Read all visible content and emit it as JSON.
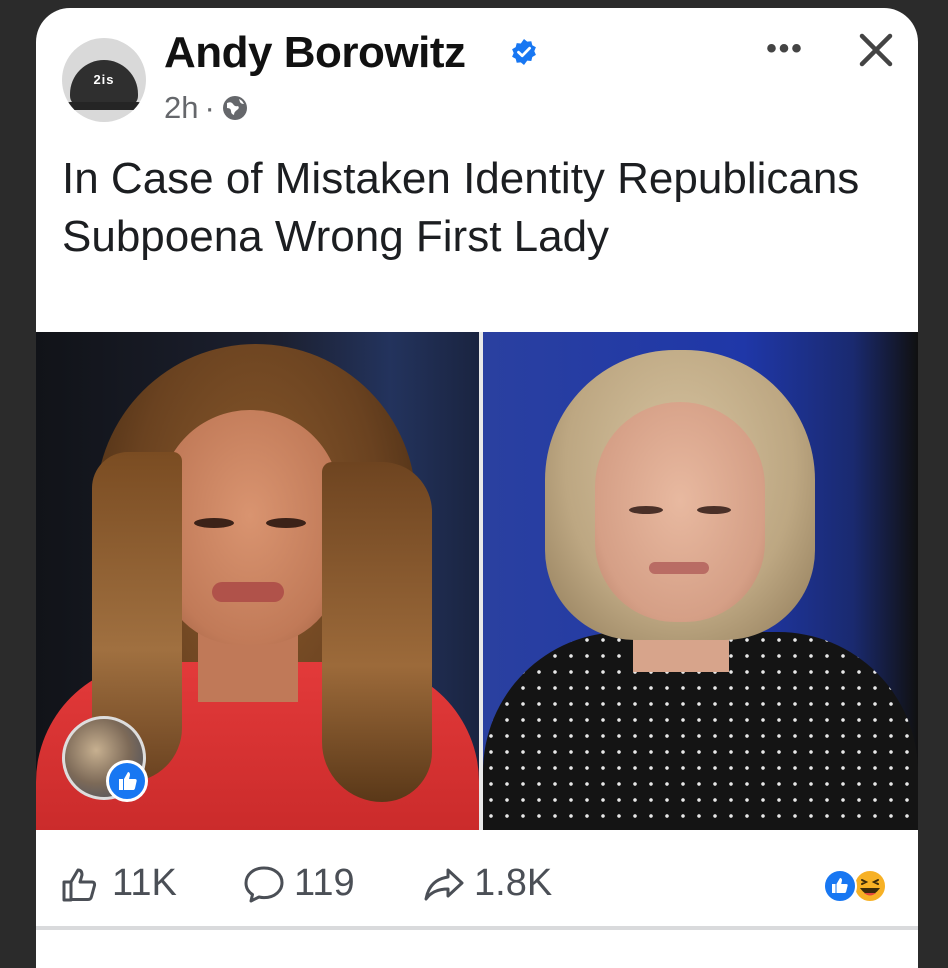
{
  "post": {
    "author": "Andy Borowitz",
    "time": "2h",
    "separator": "·",
    "text": "In Case of Mistaken Identity Republicans Subpoena Wrong First Lady",
    "avatar_cap_text": "2is",
    "more_label": "•••"
  },
  "actions": {
    "likes": "11K",
    "comments": "119",
    "shares": "1.8K"
  },
  "colors": {
    "brand_blue": "#1877f2",
    "text_primary": "#1c1e21",
    "text_secondary": "#65676b"
  },
  "icons": [
    "verified-badge-icon",
    "globe-icon",
    "more-options-icon",
    "close-icon",
    "like-icon",
    "comment-icon",
    "share-icon",
    "like-reaction-icon",
    "haha-reaction-icon"
  ]
}
